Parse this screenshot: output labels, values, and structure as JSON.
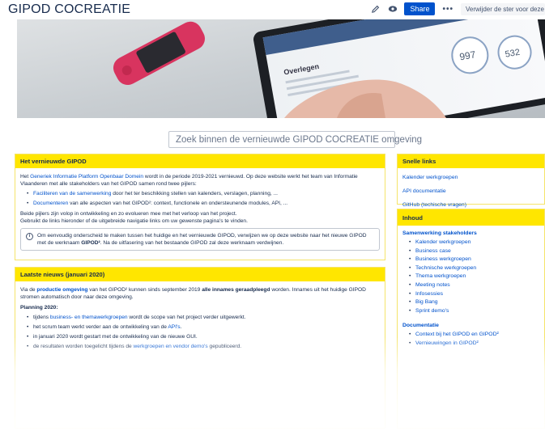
{
  "header": {
    "title": "GIPOD COCREATIE",
    "share_label": "Share",
    "more_label": "•••",
    "unstar_label": "Verwijder de ster voor deze space"
  },
  "search": {
    "placeholder": "Zoek binnen de vernieuwde GIPOD COCREATIE omgeving"
  },
  "hero_tablet": {
    "section_title": "Overlegen",
    "stat_1": "997",
    "stat_2": "532"
  },
  "intro_panel": {
    "title": "Het vernieuwde GIPOD",
    "p1_a": "Het ",
    "p1_link": "Generiek Informatie Platform Openbaar Domein",
    "p1_b": " wordt in de periode 2019-2021 vernieuwd. Op deze website werkt het team van Informatie Vlaanderen met alle stakeholders van het GIPOD samen rond twee pijlers:",
    "bullet1_link": "Faciliteren van de samenwerking",
    "bullet1_text": " door het ter beschikking stellen van kalenders, verslagen, planning, ...",
    "bullet2_link": "Documenteren",
    "bullet2_text": " van alle aspecten van het GIPOD²: context, functionele en ondersteunende modules, API, ...",
    "p2": "Beide pijlers zijn volop in ontwikkeling en zo evolueren mee met het verloop van het project.",
    "p3": "Gebruikt de links hieronder of de uitgebreide navigatie links om uw gewenste pagina's te vinden.",
    "info_a": "Om eenvoudig onderscheid te maken tussen het huidige en het vernieuwde GIPOD, verwijzen we op deze website naar het nieuwe GIPOD met de werknaam ",
    "info_bold": "GIPOD²",
    "info_b": ". Na de uitfasering van het bestaande GIPOD zal deze werknaam verdwijnen."
  },
  "news_panel": {
    "title": "Laatste nieuws (januari 2020)",
    "p1_a": "Via de ",
    "p1_link": "productie omgeving",
    "p1_b": " van het GIPOD² kunnen sinds september 2019 ",
    "p1_bold": "alle innames geraadpleegd",
    "p1_c": " worden. Innames uit het huidige GIPOD stromen automatisch door naar deze omgeving.",
    "planning_title": "Planning 2020:",
    "item1_a": "tijdens ",
    "item1_link": "business- en themawerkgroepen",
    "item1_b": " wordt de scope van het project verder uitgewerkt.",
    "item2_a": "het scrum team werkt verder aan de ontwikkeling van de ",
    "item2_link": "API's",
    "item2_b": ".",
    "item3": "in januari 2020 wordt gestart met de ontwikkeling van de nieuwe GUI.",
    "item4_a": "de resultaten worden toegelicht tijdens de ",
    "item4_link": "werkgroepen en vendor demo's",
    "item4_b": " gepubliceerd."
  },
  "quick_links": {
    "title": "Snelle links",
    "items": [
      "Kalender werkgroepen",
      "API documentatie",
      "GitHub (techische vragen)"
    ]
  },
  "contents": {
    "title": "Inhoud",
    "sec1_title": "Samenwerking stakeholders",
    "sec1_items": [
      "Kalender werkgroepen",
      "Business case",
      "Business werkgroepen",
      "Technische werkgroepen",
      "Thema werkgroepen",
      "Meeting notes",
      "Infosessies",
      "Big Bang",
      "Sprint demo's"
    ],
    "sec2_title": "Documentatie",
    "sec2_items": [
      "Context bij het GIPOD en GIPOD²",
      "Vernieuwingen in GIPOD²"
    ]
  },
  "colors": {
    "panel_header": "#ffe600",
    "link": "#0052cc",
    "primary_button": "#0052cc"
  }
}
